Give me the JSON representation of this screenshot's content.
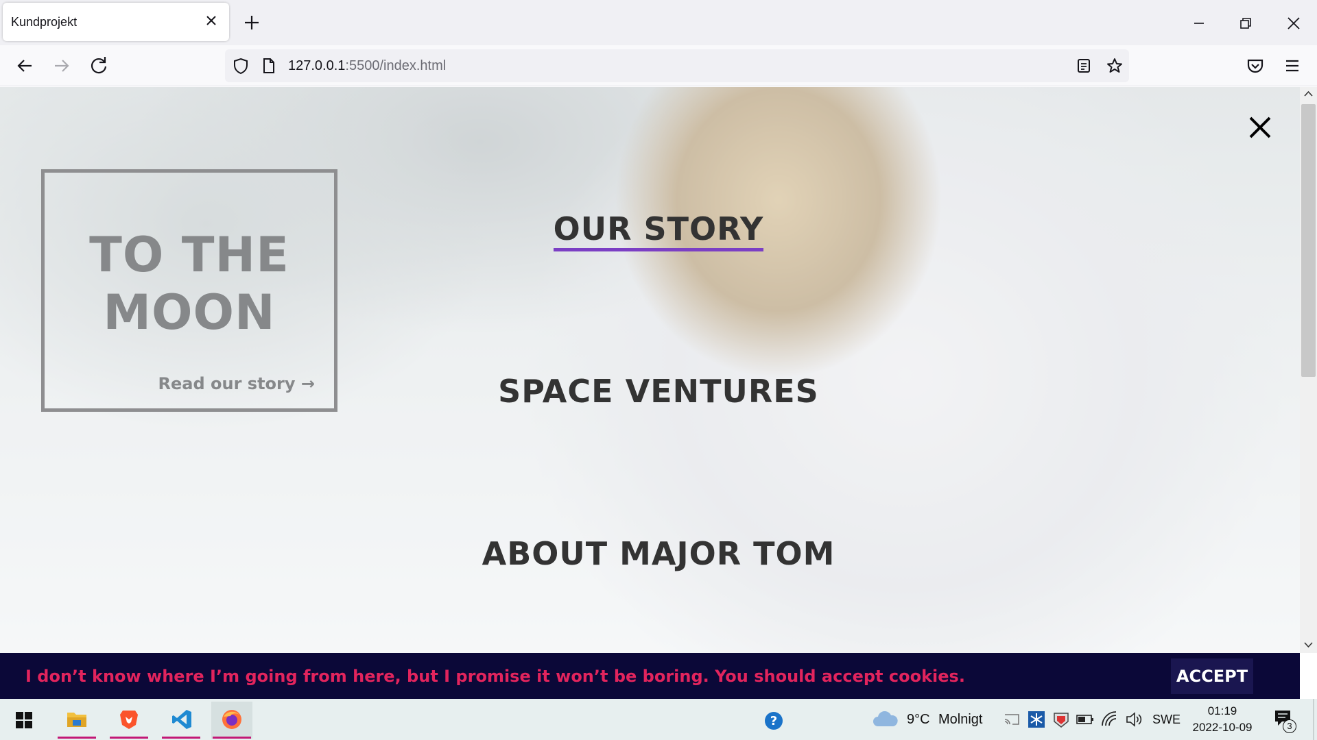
{
  "browser": {
    "tab_title": "Kundprojekt",
    "url_host": "127.0.0.1",
    "url_path": ":5500/index.html"
  },
  "hero": {
    "title_line1": "TO THE",
    "title_line2": "MOON",
    "link_label": "Read our story →"
  },
  "menu": {
    "items": [
      {
        "label": "OUR STORY",
        "active": true
      },
      {
        "label": "SPACE VENTURES",
        "active": false
      },
      {
        "label": "ABOUT MAJOR TOM",
        "active": false
      }
    ]
  },
  "cookie_banner": {
    "message": "I don’t know where I’m going from here, but I promise it won’t be boring. You should accept cookies.",
    "accept_label": "ACCEPT"
  },
  "colors": {
    "accent_underline": "#7b3fc4",
    "banner_bg": "#0b0838",
    "banner_text": "#e2245d"
  },
  "taskbar": {
    "weather_temp": "9°C",
    "weather_desc": "Molnigt",
    "language": "SWE",
    "time": "01:19",
    "date": "2022-10-09",
    "notification_count": "3",
    "apps": [
      "windows-start",
      "file-explorer",
      "brave-browser",
      "vscode",
      "firefox"
    ]
  }
}
